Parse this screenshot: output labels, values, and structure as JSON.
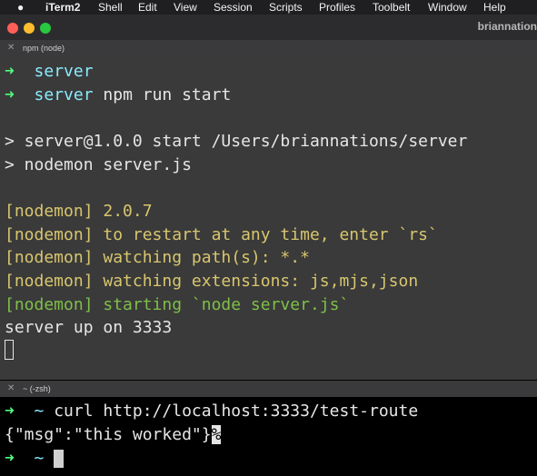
{
  "menubar": {
    "apple": "",
    "app_name": "iTerm2",
    "items": [
      "Shell",
      "Edit",
      "View",
      "Session",
      "Scripts",
      "Profiles",
      "Toolbelt",
      "Window",
      "Help"
    ]
  },
  "window": {
    "title": "briannation"
  },
  "pane1": {
    "tab_close": "✕",
    "tab_label": "npm (node)",
    "lines": {
      "l1_arrow": "➜",
      "l1_dir": "server",
      "l2_arrow": "➜",
      "l2_dir": "server",
      "l2_cmd": " npm run start",
      "l3": "> server@1.0.0 start /Users/briannations/server",
      "l4": "> nodemon server.js",
      "l5": "[nodemon] 2.0.7",
      "l6": "[nodemon] to restart at any time, enter `rs`",
      "l7": "[nodemon] watching path(s): *.*",
      "l8": "[nodemon] watching extensions: js,mjs,json",
      "l9": "[nodemon] starting `node server.js`",
      "l10": "server up on 3333"
    }
  },
  "pane2": {
    "tab_close": "✕",
    "tab_label": "~ (-zsh)",
    "lines": {
      "l1_arrow": "➜",
      "l1_dir": "~",
      "l1_cmd": " curl http://localhost:3333/test-route",
      "l2_out": "{\"msg\":\"this worked\"}",
      "l2_pct": "%",
      "l3_arrow": "➜",
      "l3_dir": "~"
    }
  },
  "colors": {
    "prompt_arrow": "#50fa7b",
    "dir": "#8be9fd",
    "nodemon_yellow": "#d8c66e",
    "nodemon_green": "#7fbf4a"
  }
}
